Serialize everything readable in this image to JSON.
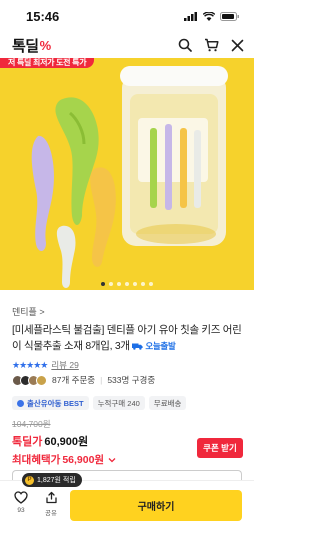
{
  "status": {
    "time": "15:46"
  },
  "header": {
    "logo": "톡딜",
    "logo_mark": "%"
  },
  "hero": {
    "banner_text": "저 특딜 최저가 도전 특가",
    "slide_count": 7,
    "active_slide": 1
  },
  "product": {
    "brand": "덴티플 >",
    "title": "[미세플라스틱 불검출] 덴티플 아기 유아 칫솔 키즈 어린이 식물추출 소재 8개입, 3개",
    "delivery_badge": "오늘출발",
    "rating": {
      "stars": "★★★★★",
      "reviews": "리뷰 29",
      "value": 5
    },
    "orders": "87개 주문중",
    "wishlist": "533명 구경중",
    "tags": [
      "출산유아동 BEST",
      "누적구매 240",
      "무료배송"
    ]
  },
  "price": {
    "original": "104,700원",
    "deal_label": "톡딜가",
    "deal_price": "60,900원",
    "benefit_label": "최대혜택가",
    "benefit_price": "56,900원",
    "coupon_button": "쿠폰 받기"
  },
  "bottom_bar": {
    "points_chip": "1,827원 적립",
    "like_count": "93",
    "share_label": "공유",
    "buy_button": "구매하기"
  },
  "colors": {
    "accent": "#f0283c",
    "buy": "#ffd21f",
    "hero_bg": "#f6d22c",
    "star": "#2f6fea"
  }
}
